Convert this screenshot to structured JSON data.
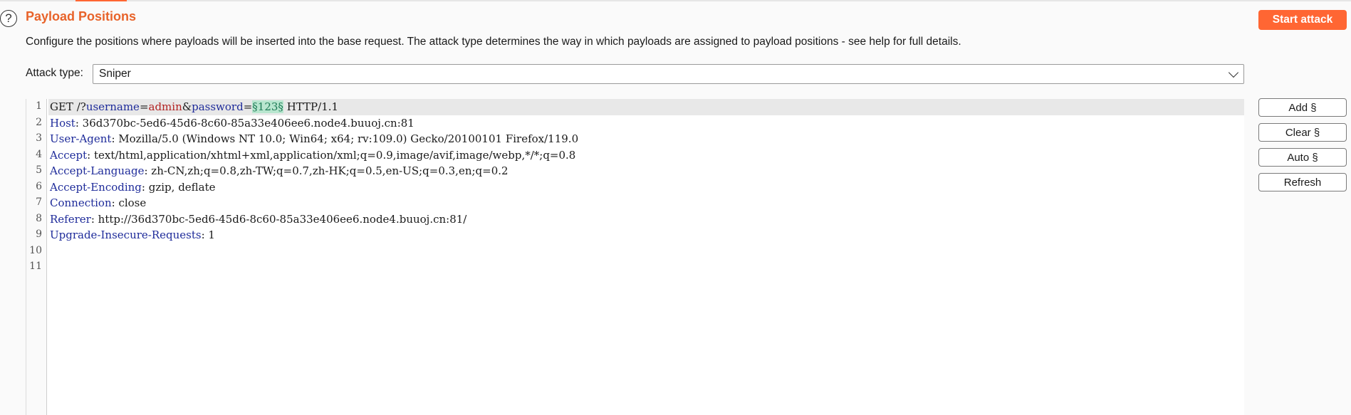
{
  "section": {
    "title": "Payload Positions",
    "description": "Configure the positions where payloads will be inserted into the base request. The attack type determines the way in which payloads are assigned to payload positions - see help for full details.",
    "help_icon_glyph": "?"
  },
  "buttons": {
    "start_attack": "Start attack",
    "add": "Add §",
    "clear": "Clear §",
    "auto": "Auto §",
    "refresh": "Refresh"
  },
  "attack_type": {
    "label": "Attack type:",
    "value": "Sniper"
  },
  "request": {
    "line_numbers": [
      "1",
      "2",
      "3",
      "4",
      "5",
      "6",
      "7",
      "8",
      "9",
      "10",
      "11"
    ],
    "request_line": {
      "method": "GET /?",
      "param1_key": "username",
      "eq1": "=",
      "param1_value": "admin",
      "amp": "&",
      "param2_key": "password",
      "eq2": "=",
      "payload_marker": "§123§",
      "protocol": " HTTP/1.1"
    },
    "headers": [
      {
        "name": "Host",
        "sep": ": ",
        "value": "36d370bc-5ed6-45d6-8c60-85a33e406ee6.node4.buuoj.cn:81"
      },
      {
        "name": "User-Agent",
        "sep": ": ",
        "value": "Mozilla/5.0 (Windows NT 10.0; Win64; x64; rv:109.0) Gecko/20100101 Firefox/119.0"
      },
      {
        "name": "Accept",
        "sep": ": ",
        "value": "text/html,application/xhtml+xml,application/xml;q=0.9,image/avif,image/webp,*/*;q=0.8"
      },
      {
        "name": "Accept-Language",
        "sep": ": ",
        "value": "zh-CN,zh;q=0.8,zh-TW;q=0.7,zh-HK;q=0.5,en-US;q=0.3,en;q=0.2"
      },
      {
        "name": "Accept-Encoding",
        "sep": ": ",
        "value": "gzip, deflate"
      },
      {
        "name": "Connection",
        "sep": ": ",
        "value": "close"
      },
      {
        "name": "Referer",
        "sep": ": ",
        "value": "http://36d370bc-5ed6-45d6-8c60-85a33e406ee6.node4.buuoj.cn:81/"
      },
      {
        "name": "Upgrade-Insecure-Requests",
        "sep": ": ",
        "value": "1"
      }
    ]
  },
  "colors": {
    "accent": "#ff6633",
    "title": "#e8632a",
    "header_name": "#1e2b9a",
    "param_value": "#b22222",
    "payload_bg": "#b8e6cf"
  }
}
